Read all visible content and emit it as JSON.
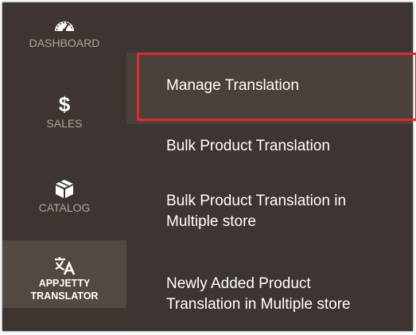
{
  "nav": {
    "items": [
      {
        "id": "dashboard",
        "label": "DASHBOARD",
        "icon": "speedometer-icon"
      },
      {
        "id": "sales",
        "label": "SALES",
        "icon": "dollar-icon",
        "glyph": "$"
      },
      {
        "id": "catalog",
        "label": "CATALOG",
        "icon": "box-icon"
      },
      {
        "id": "appjetty",
        "label_line1": "APPJETTY",
        "label_line2": "TRANSLATOR",
        "icon": "translate-icon",
        "active": true
      }
    ]
  },
  "submenu": {
    "items": [
      {
        "label": "Manage Translation",
        "selected": true
      },
      {
        "label": "Bulk Product Translation"
      },
      {
        "label_line1": "Bulk Product Translation in",
        "label_line2": "Multiple store"
      },
      {
        "label_line1": "Newly Added Product",
        "label_line2": "Translation in Multiple store"
      }
    ]
  },
  "colors": {
    "background": "#3d3531",
    "active_nav": "#514943",
    "highlight_border": "#e02b27",
    "text": "#ffffff",
    "muted_text": "#aaa6a0"
  }
}
